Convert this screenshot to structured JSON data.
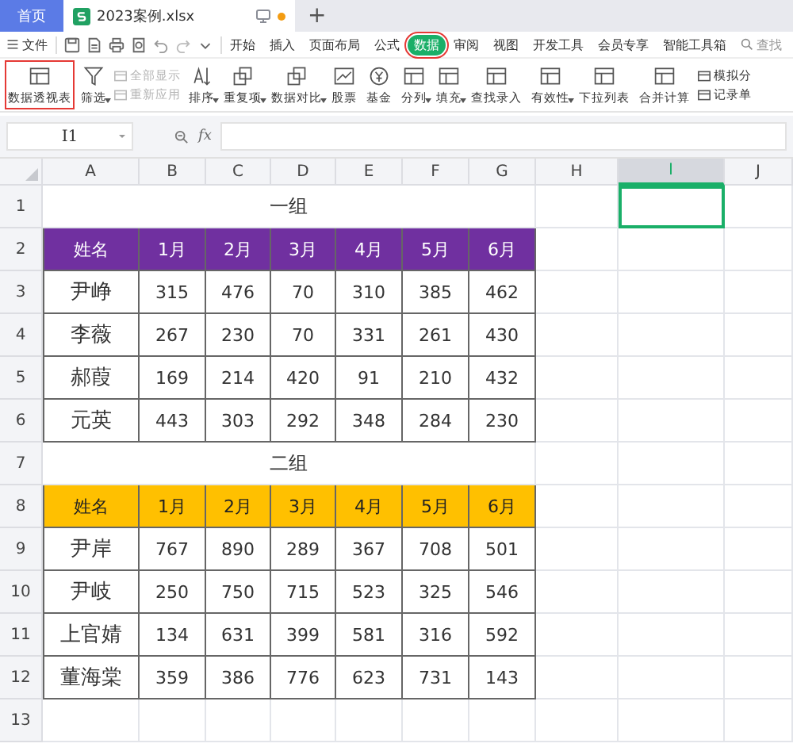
{
  "tabs": [
    {
      "label": "首页",
      "kind": "home",
      "selected": false,
      "modified": false
    },
    {
      "label": "2023案例.xlsx",
      "kind": "file",
      "selected": true,
      "modified": true
    }
  ],
  "new_tab": "+",
  "menu": {
    "file": "文件",
    "tabs": [
      {
        "label": "开始",
        "selected": false,
        "highlighted": false
      },
      {
        "label": "插入",
        "selected": false,
        "highlighted": false
      },
      {
        "label": "页面布局",
        "selected": false,
        "highlighted": false
      },
      {
        "label": "公式",
        "selected": false,
        "highlighted": false
      },
      {
        "label": "数据",
        "selected": true,
        "highlighted": true
      },
      {
        "label": "审阅",
        "selected": false,
        "highlighted": false
      },
      {
        "label": "视图",
        "selected": false,
        "highlighted": false
      },
      {
        "label": "开发工具",
        "selected": false,
        "highlighted": false
      },
      {
        "label": "会员专享",
        "selected": false,
        "highlighted": false
      },
      {
        "label": "智能工具箱",
        "selected": false,
        "highlighted": false
      }
    ],
    "search": "查找"
  },
  "ribbon": [
    {
      "kind": "large",
      "label": "数据透视表",
      "dropdown": false,
      "highlighted": true
    },
    {
      "kind": "large",
      "label": "筛选",
      "dropdown": true,
      "highlighted": false
    },
    {
      "kind": "stack",
      "items": [
        {
          "label": "全部显示",
          "disabled": true
        },
        {
          "label": "重新应用",
          "disabled": true
        }
      ]
    },
    {
      "kind": "large",
      "label": "排序",
      "dropdown": true,
      "highlighted": false
    },
    {
      "kind": "large",
      "label": "重复项",
      "dropdown": true,
      "highlighted": false
    },
    {
      "kind": "large",
      "label": "数据对比",
      "dropdown": true,
      "highlighted": false
    },
    {
      "kind": "large",
      "label": "股票",
      "dropdown": false,
      "highlighted": false
    },
    {
      "kind": "large",
      "label": "基金",
      "dropdown": false,
      "highlighted": false
    },
    {
      "kind": "large",
      "label": "分列",
      "dropdown": true,
      "highlighted": false
    },
    {
      "kind": "large",
      "label": "填充",
      "dropdown": true,
      "highlighted": false
    },
    {
      "kind": "large",
      "label": "查找录入",
      "dropdown": false,
      "highlighted": false
    },
    {
      "kind": "large",
      "label": "有效性",
      "dropdown": true,
      "highlighted": false
    },
    {
      "kind": "large",
      "label": "下拉列表",
      "dropdown": false,
      "highlighted": false
    },
    {
      "kind": "large",
      "label": "合并计算",
      "dropdown": false,
      "highlighted": false
    },
    {
      "kind": "stack",
      "items": [
        {
          "label": "模拟分",
          "disabled": false
        },
        {
          "label": "记录单",
          "disabled": false
        }
      ]
    }
  ],
  "formula_bar": {
    "name_box": "I1",
    "fx": "fx"
  },
  "sheet": {
    "columns": [
      {
        "label": "A",
        "selected": false
      },
      {
        "label": "B",
        "selected": false
      },
      {
        "label": "C",
        "selected": false
      },
      {
        "label": "D",
        "selected": false
      },
      {
        "label": "E",
        "selected": false
      },
      {
        "label": "F",
        "selected": false
      },
      {
        "label": "G",
        "selected": false
      },
      {
        "label": "H",
        "selected": false
      },
      {
        "label": "I",
        "selected": true
      },
      {
        "label": "J",
        "selected": false
      }
    ],
    "row_numbers": [
      "1",
      "2",
      "3",
      "4",
      "5",
      "6",
      "7",
      "8",
      "9",
      "10",
      "11",
      "12",
      "13"
    ],
    "groups": [
      {
        "title": "一组",
        "color": "#7030a0",
        "header": [
          "姓名",
          "1月",
          "2月",
          "3月",
          "4月",
          "5月",
          "6月"
        ],
        "rows": [
          [
            "尹峥",
            "315",
            "476",
            "70",
            "310",
            "385",
            "462"
          ],
          [
            "李薇",
            "267",
            "230",
            "70",
            "331",
            "261",
            "430"
          ],
          [
            "郝葭",
            "169",
            "214",
            "420",
            "91",
            "210",
            "432"
          ],
          [
            "元英",
            "443",
            "303",
            "292",
            "348",
            "284",
            "230"
          ]
        ]
      },
      {
        "title": "二组",
        "color": "#ffc000",
        "header": [
          "姓名",
          "1月",
          "2月",
          "3月",
          "4月",
          "5月",
          "6月"
        ],
        "rows": [
          [
            "尹岸",
            "767",
            "890",
            "289",
            "367",
            "708",
            "501"
          ],
          [
            "尹岐",
            "250",
            "750",
            "715",
            "523",
            "325",
            "546"
          ],
          [
            "上官婧",
            "134",
            "631",
            "399",
            "581",
            "316",
            "592"
          ],
          [
            "董海棠",
            "359",
            "386",
            "776",
            "623",
            "731",
            "143"
          ]
        ]
      }
    ]
  }
}
